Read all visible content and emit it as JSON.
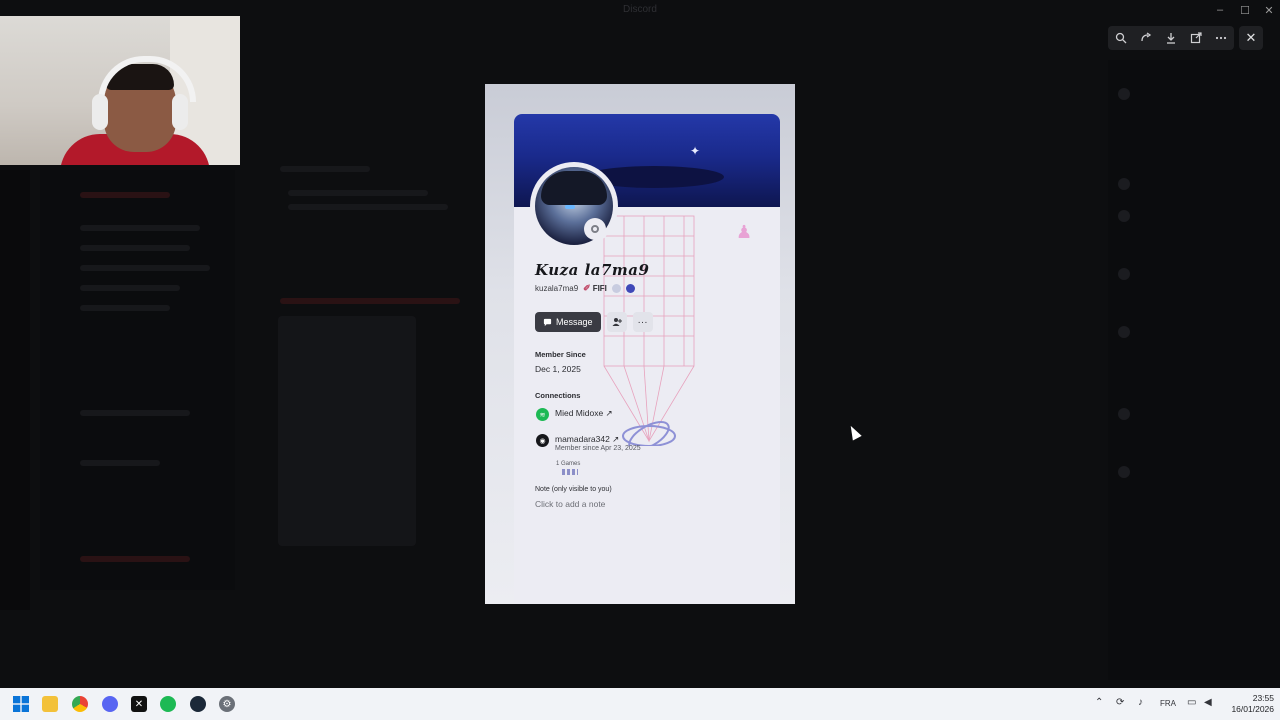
{
  "window": {
    "title": "Discord",
    "minimize_label": "–",
    "maximize_label": "☐",
    "close_label": "✕"
  },
  "viewer": {
    "tools": [
      "zoom-in-icon",
      "rotate-icon",
      "download-icon",
      "open-external-icon",
      "more-icon"
    ],
    "close_label": "✕"
  },
  "profile": {
    "display_name": "Kuza la7ma9",
    "username": "kuzala7ma9",
    "tag": "FIFI",
    "message_button": "Message",
    "member_since_label": "Member Since",
    "member_since_value": "Dec 1, 2025",
    "connections_label": "Connections",
    "connections": [
      {
        "service": "spotify",
        "name": "Mied Midoxe ↗"
      },
      {
        "service": "steam",
        "name": "mamadara342 ↗",
        "sub": "Member since Apr 23, 2025",
        "games": "1 Games"
      }
    ],
    "note_label": "Note (only visible to you)",
    "note_placeholder": "Click to add a note"
  },
  "colors": {
    "accent": "#3a3b43",
    "banner": "#1a2a8c",
    "spotify": "#1db954",
    "status_offline": "#7d7f88"
  },
  "taskbar": {
    "language": "FRA",
    "time": "23:55",
    "date": "16/01/2026",
    "apps": [
      "windows-start-icon",
      "file-explorer-icon",
      "chrome-icon",
      "discord-icon",
      "capcut-icon",
      "spotify-icon",
      "steam-icon",
      "settings-icon"
    ]
  }
}
